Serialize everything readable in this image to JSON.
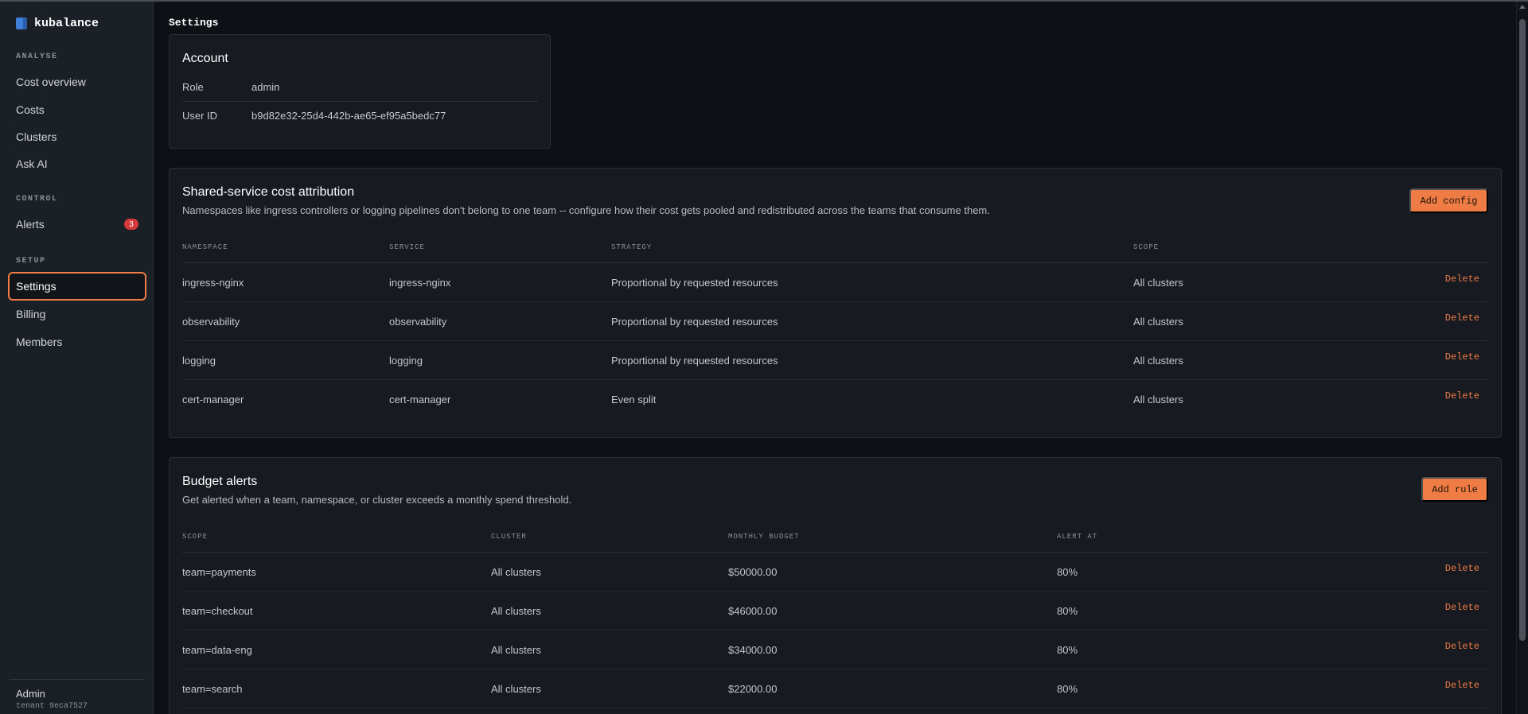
{
  "app": {
    "name": "kubalance"
  },
  "sidebar": {
    "sections": [
      "ANALYSE",
      "CONTROL",
      "SETUP"
    ],
    "analyse_items": [
      "Cost overview",
      "Costs",
      "Clusters",
      "Ask AI"
    ],
    "control_items": [
      {
        "label": "Alerts",
        "badge": "3"
      }
    ],
    "setup_items": [
      "Settings",
      "Billing",
      "Members"
    ],
    "active": "Settings",
    "footer": {
      "user": "Admin",
      "tenant": "tenant 9eca7527"
    }
  },
  "page": {
    "title": "Settings"
  },
  "account": {
    "title": "Account",
    "role_label": "Role",
    "role_value": "admin",
    "user_id_label": "User ID",
    "user_id_value": "b9d82e32-25d4-442b-ae65-ef95a5bedc77"
  },
  "shared_service": {
    "title": "Shared-service cost attribution",
    "description": "Namespaces like ingress controllers or logging pipelines don't belong to one team -- configure how their cost gets pooled and redistributed across the teams that consume them.",
    "add_button": "Add config",
    "columns": [
      "NAMESPACE",
      "SERVICE",
      "STRATEGY",
      "SCOPE"
    ],
    "rows": [
      {
        "namespace": "ingress-nginx",
        "service": "ingress-nginx",
        "strategy": "Proportional by requested resources",
        "scope": "All clusters"
      },
      {
        "namespace": "observability",
        "service": "observability",
        "strategy": "Proportional by requested resources",
        "scope": "All clusters"
      },
      {
        "namespace": "logging",
        "service": "logging",
        "strategy": "Proportional by requested resources",
        "scope": "All clusters"
      },
      {
        "namespace": "cert-manager",
        "service": "cert-manager",
        "strategy": "Even split",
        "scope": "All clusters"
      }
    ],
    "delete_label": "Delete"
  },
  "budget_alerts": {
    "title": "Budget alerts",
    "description": "Get alerted when a team, namespace, or cluster exceeds a monthly spend threshold.",
    "add_button": "Add rule",
    "columns": [
      "SCOPE",
      "CLUSTER",
      "MONTHLY BUDGET",
      "ALERT AT"
    ],
    "rows": [
      {
        "scope": "team=payments",
        "cluster": "All clusters",
        "budget": "$50000.00",
        "alert_at": "80%"
      },
      {
        "scope": "team=checkout",
        "cluster": "All clusters",
        "budget": "$46000.00",
        "alert_at": "80%"
      },
      {
        "scope": "team=data-eng",
        "cluster": "All clusters",
        "budget": "$34000.00",
        "alert_at": "80%"
      },
      {
        "scope": "team=search",
        "cluster": "All clusters",
        "budget": "$22000.00",
        "alert_at": "80%"
      }
    ],
    "delete_label": "Delete"
  },
  "colors": {
    "accent": "#f07c45",
    "badge": "#d6393a",
    "background": "#0d1015",
    "card": "#171a20"
  }
}
